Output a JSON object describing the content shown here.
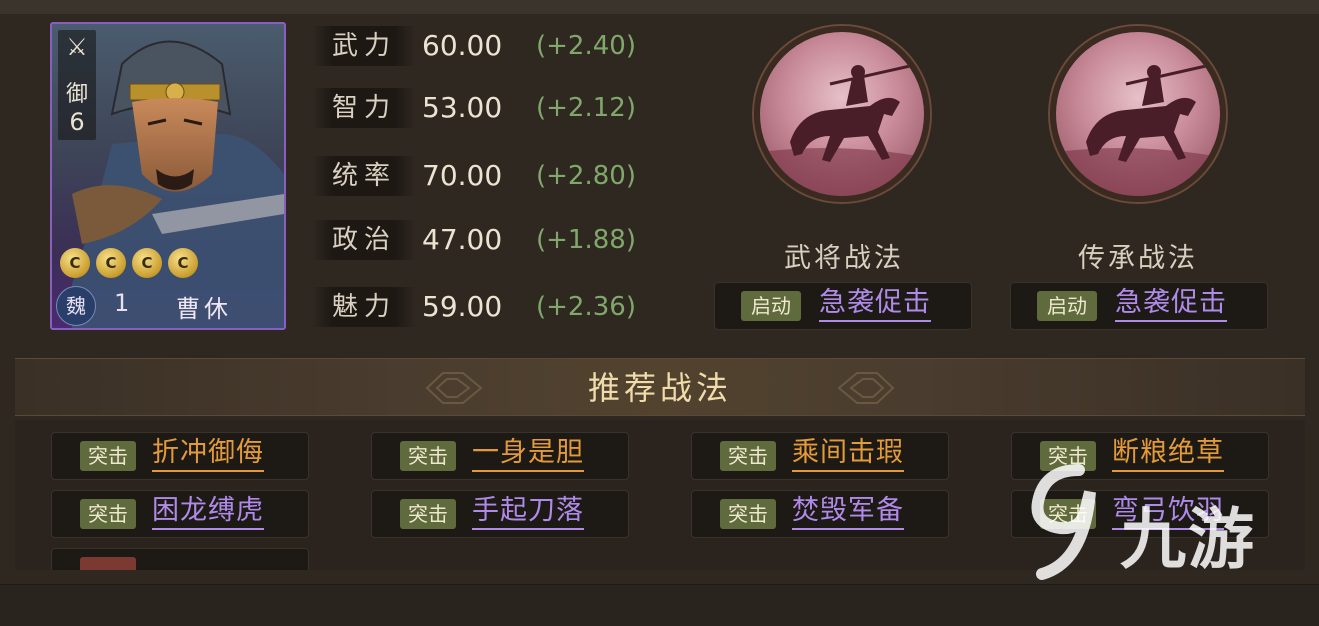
{
  "hero": {
    "type_icon": "⚔",
    "defense": "御",
    "cost": "6",
    "stars": [
      "C",
      "C",
      "C",
      "C"
    ],
    "faction": "魏",
    "level": "1",
    "name": "曹休"
  },
  "stats": [
    {
      "label": "武力",
      "value": "60.00",
      "bonus": "(+2.40)"
    },
    {
      "label": "智力",
      "value": "53.00",
      "bonus": "(+2.12)"
    },
    {
      "label": "统率",
      "value": "70.00",
      "bonus": "(+2.80)"
    },
    {
      "label": "政治",
      "value": "47.00",
      "bonus": "(+1.88)"
    },
    {
      "label": "魅力",
      "value": "59.00",
      "bonus": "(+2.36)"
    }
  ],
  "tactics": [
    {
      "caption": "武将战法",
      "badge": "启动",
      "name": "急袭促击"
    },
    {
      "caption": "传承战法",
      "badge": "启动",
      "name": "急袭促击"
    }
  ],
  "recommended": {
    "title": "推荐战法",
    "items": [
      {
        "badge": "突击",
        "name": "折冲御侮",
        "color": "#e39a3a"
      },
      {
        "badge": "突击",
        "name": "一身是胆",
        "color": "#e39a3a"
      },
      {
        "badge": "突击",
        "name": "乘间击瑕",
        "color": "#e39a3a"
      },
      {
        "badge": "突击",
        "name": "断粮绝草",
        "color": "#e39a3a"
      },
      {
        "badge": "突击",
        "name": "困龙缚虎",
        "color": "#b08ae8"
      },
      {
        "badge": "突击",
        "name": "手起刀落",
        "color": "#b08ae8"
      },
      {
        "badge": "突击",
        "name": "焚毁军备",
        "color": "#b08ae8"
      },
      {
        "badge": "突击",
        "name": "弯弓饮羽",
        "color": "#b08ae8"
      },
      {
        "badge": "",
        "name": "",
        "color": "#b08ae8"
      }
    ]
  },
  "watermark": {
    "text": "九游"
  },
  "colors": {
    "accent_gold": "#f0dcaa",
    "stat_bonus": "#7fa86a",
    "legendary_purple": "#b08ae8",
    "orange": "#e39a3a",
    "badge_green": "#5f6b3d"
  }
}
